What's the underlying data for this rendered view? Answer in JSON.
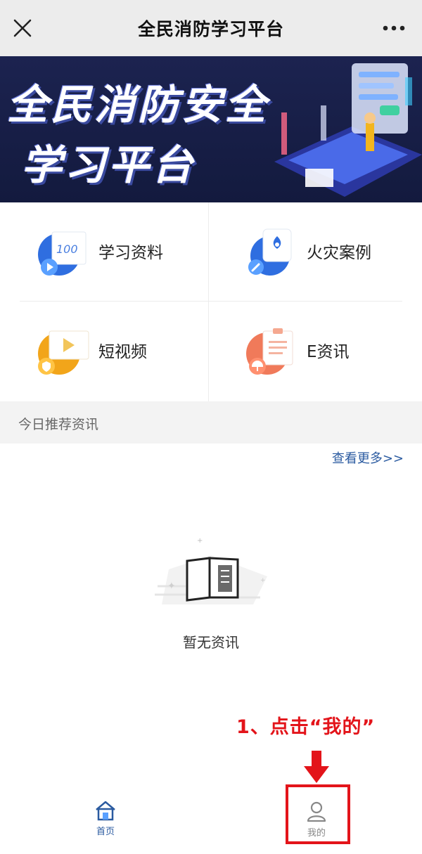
{
  "header": {
    "title": "全民消防学习平台"
  },
  "banner": {
    "line1": "全民消防安全",
    "line2": "学习平台"
  },
  "grid": {
    "items": [
      {
        "label": "学习资料",
        "icon": "study-materials-icon"
      },
      {
        "label": "火灾案例",
        "icon": "fire-case-icon"
      },
      {
        "label": "短视频",
        "icon": "short-video-icon"
      },
      {
        "label": "E资讯",
        "icon": "e-news-icon"
      }
    ]
  },
  "section": {
    "title": "今日推荐资讯",
    "more_link": "查看更多>>",
    "empty_text": "暂无资讯"
  },
  "annotation": {
    "text": "1、点击“我的”"
  },
  "tabbar": {
    "home_label": "首页",
    "mine_label": "我的"
  },
  "colors": {
    "accent": "#2a5aa0",
    "annotation": "#e3141a",
    "banner_bg": "#1c2350"
  }
}
